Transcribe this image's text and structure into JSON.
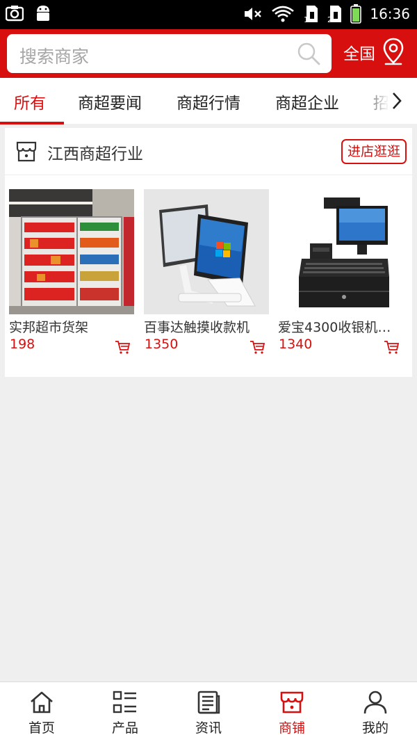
{
  "statusbar": {
    "time": "16:36"
  },
  "header": {
    "search_placeholder": "搜索商家",
    "region": "全国"
  },
  "tabs": [
    {
      "label": "所有",
      "active": true
    },
    {
      "label": "商超要闻"
    },
    {
      "label": "商超行情"
    },
    {
      "label": "商超企业"
    },
    {
      "label": "招"
    }
  ],
  "store": {
    "name": "江西商超行业",
    "visit_label": "进店逛逛",
    "products": [
      {
        "title": "实邦超市货架",
        "price": "198"
      },
      {
        "title": "百事达触摸收款机",
        "price": "1350"
      },
      {
        "title": "爱宝4300收银机…",
        "price": "1340"
      }
    ]
  },
  "bottom_nav": [
    {
      "label": "首页",
      "icon": "home-icon"
    },
    {
      "label": "产品",
      "icon": "list-icon"
    },
    {
      "label": "资讯",
      "icon": "news-icon"
    },
    {
      "label": "商铺",
      "icon": "shop-icon",
      "active": true
    },
    {
      "label": "我的",
      "icon": "user-icon"
    }
  ],
  "colors": {
    "accent": "#d80f0f",
    "background": "#efefef"
  }
}
